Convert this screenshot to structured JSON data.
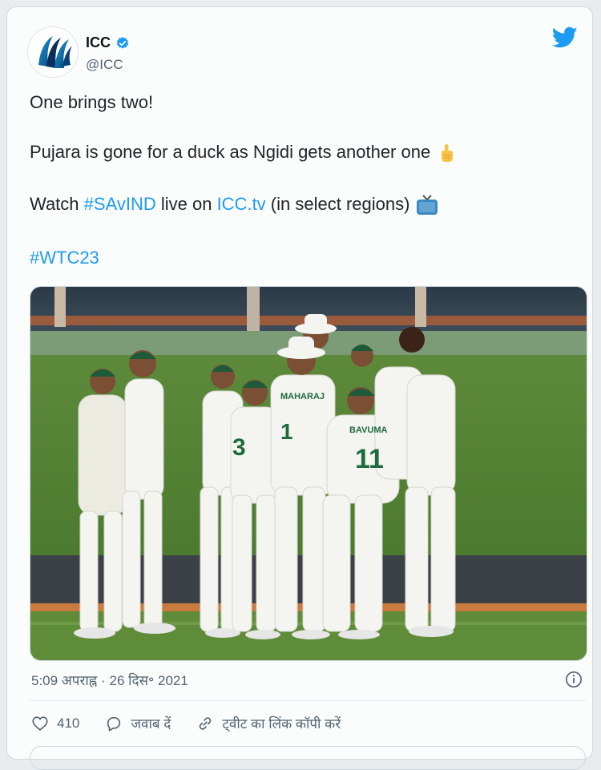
{
  "tweet": {
    "author_name": "ICC",
    "handle": "@ICC",
    "line1": "One brings two!",
    "line2": "Pujara is gone for a duck as Ngidi gets another one",
    "line3_prefix": "Watch ",
    "line3_hashtag": "#SAvIND",
    "line3_mid": " live on ",
    "line3_link": "ICC.tv",
    "line3_suffix": " (in select regions)",
    "hashtag_line": "#WTC23",
    "timestamp": "5:09 अपराह्न · 26 दिस॰ 2021",
    "likes": "410",
    "reply_label": "जवाब दें",
    "copy_link_label": "ट्वीट का लिंक कॉपी करें"
  },
  "colors": {
    "link": "#1d9bf0",
    "muted": "#536471",
    "twitter_blue": "#1d9bf0"
  },
  "icons": {
    "brand": "twitter-bird-icon",
    "verified": "verified-badge-icon",
    "point": "point-up-emoji",
    "tv": "tv-emoji",
    "info": "info-icon",
    "like": "heart-icon",
    "reply": "reply-bubble-icon",
    "link": "link-icon"
  }
}
